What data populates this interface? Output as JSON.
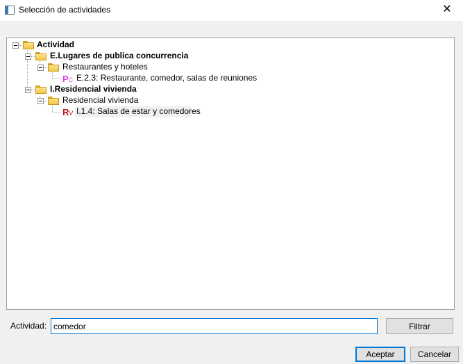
{
  "window": {
    "title": "Selección de actividades",
    "close_glyph": "✕",
    "app_icon": "window-app-icon"
  },
  "tree": {
    "root": {
      "label": "Actividad",
      "icon": "folder-icon"
    },
    "groups": [
      {
        "label": "E.Lugares de publica concurrencia",
        "sub": {
          "label": "Restaurantes y hoteles",
          "item": {
            "badge_main": "P",
            "badge_sub": "C",
            "label": "E.2.3: Restaurante, comedor, salas de reuniones",
            "color": "#d946d9"
          }
        }
      },
      {
        "label": "I.Residencial vivienda",
        "sub": {
          "label": "Residencial vivienda",
          "item": {
            "badge_main": "R",
            "badge_sub": "V",
            "label": "I.1.4: Salas de estar y comedores",
            "color": "#c0131a"
          }
        }
      }
    ]
  },
  "filter": {
    "label": "Actividad:",
    "value": "comedor",
    "button": "Filtrar"
  },
  "footer": {
    "accept": "Aceptar",
    "cancel": "Cancelar"
  },
  "colors": {
    "focus": "#0078d7",
    "folder": "#f3c64a"
  }
}
